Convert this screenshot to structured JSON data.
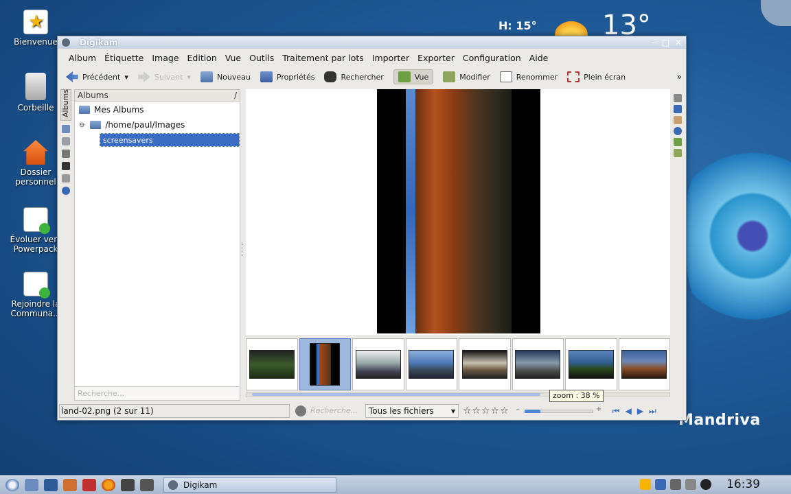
{
  "desktop": {
    "icons": [
      {
        "label": "Bienvenue"
      },
      {
        "label": "Corbeille"
      },
      {
        "label": "Dossier personnel"
      },
      {
        "label": "Évoluer vers Powerpack"
      },
      {
        "label": "Rejoindre la Communa..."
      }
    ],
    "weather": {
      "high": "H: 15°",
      "temp": "13°"
    },
    "brand": "Mandriva"
  },
  "window": {
    "title": "Digikam",
    "menu": [
      "Album",
      "Étiquette",
      "Image",
      "Edition",
      "Vue",
      "Outils",
      "Traitement par lots",
      "Importer",
      "Exporter",
      "Configuration",
      "Aide"
    ],
    "toolbar": {
      "prev": "Précédent",
      "next": "Suivant",
      "new": "Nouveau",
      "props": "Propriétés",
      "search": "Rechercher",
      "view": "Vue",
      "edit": "Modifier",
      "rename": "Renommer",
      "fullscreen": "Plein écran"
    },
    "side_tab": "Albums",
    "albums": {
      "header": "Albums",
      "root": "Mes Albums",
      "path": "/home/paul/Images",
      "selected": "screensavers",
      "search_placeholder": "Recherche..."
    },
    "thumbnails_count": 8,
    "zoom_label": "zoom : 38 %",
    "status": {
      "file": "land-02.png (2 sur 11)",
      "search_placeholder": "Recherche...",
      "filter": "Tous les fichiers",
      "stars": "☆☆☆☆☆",
      "zoom_fraction": 0.38
    }
  },
  "taskbar": {
    "task": "Digikam",
    "clock": "16:39"
  }
}
